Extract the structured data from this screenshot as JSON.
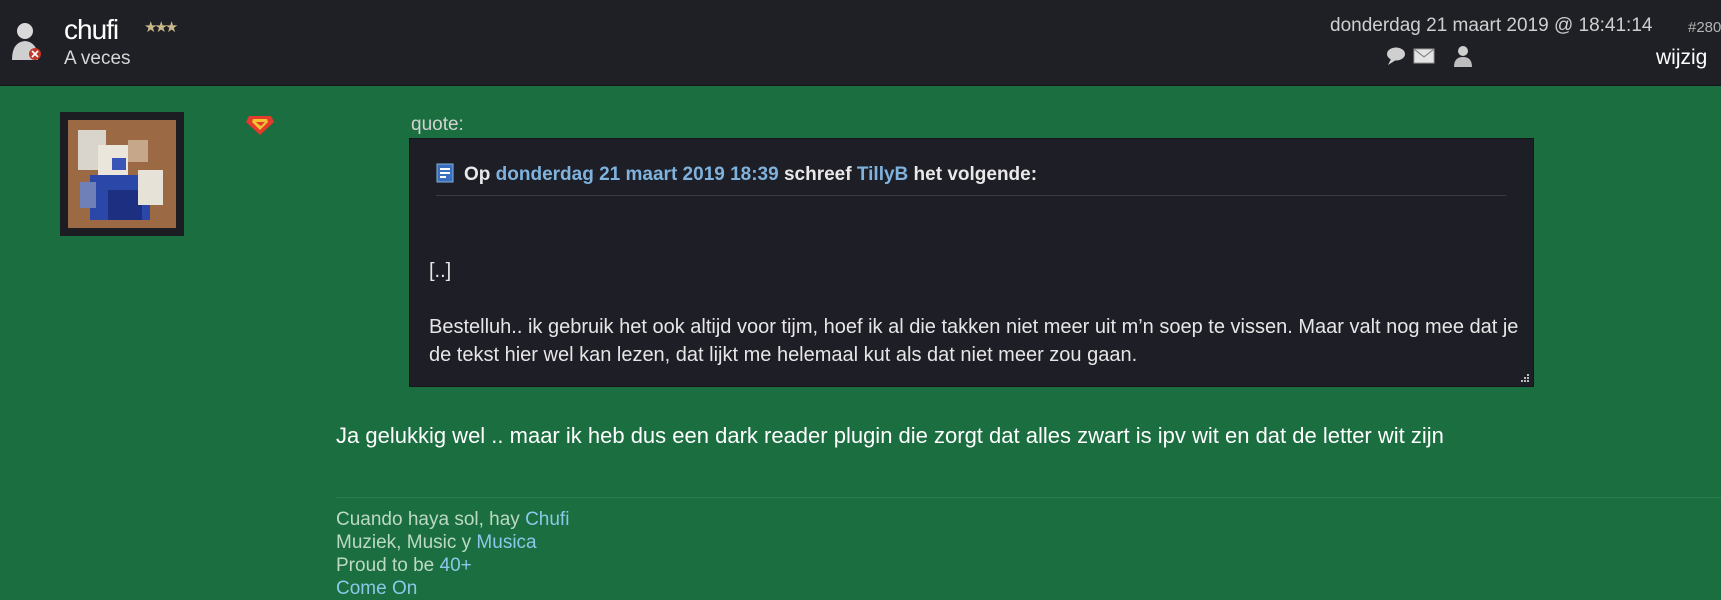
{
  "header": {
    "username": "chufi",
    "stars": "★★★",
    "subtitle": "A veces",
    "post_date": "donderdag 21 maart 2019 @ 18:41:14",
    "post_number": "#280",
    "edit_label": "wijzig",
    "icons": [
      "chat-bubble-icon",
      "mail-icon",
      "user-profile-icon"
    ]
  },
  "avatar": {
    "icon": "avatar-image"
  },
  "quote": {
    "label": "quote:",
    "intro_prefix": "Op",
    "date_link": "donderdag 21 maart 2019 18:39",
    "wrote": "schreef",
    "author_link": "TillyB",
    "suffix": "het volgende:",
    "ellipsis": "[..]",
    "body": "Bestelluh.. ik gebruik het ook altijd voor tijm, hoef ik al die takken niet meer uit m’n soep te vissen. Maar valt nog mee dat je de tekst hier wel kan lezen, dat lijkt me helemaal kut als dat niet meer zou gaan."
  },
  "reply": {
    "text": "Ja gelukkig wel .. maar ik heb dus een dark reader plugin die zorgt dat alles zwart is ipv wit en dat de letter wit zijn"
  },
  "signature": {
    "line1_text": "Cuando haya sol, hay",
    "line1_link": "Chufi",
    "line2_text": "Muziek, Music y",
    "line2_link": "Musica",
    "line3_text": "Proud to be",
    "line3_link": "40+",
    "line4_link": "Come On"
  },
  "colors": {
    "page_background": "#1a6e3f",
    "header_background": "#1f2026",
    "quote_background": "#1e1e26",
    "link": "#7fb3de"
  }
}
